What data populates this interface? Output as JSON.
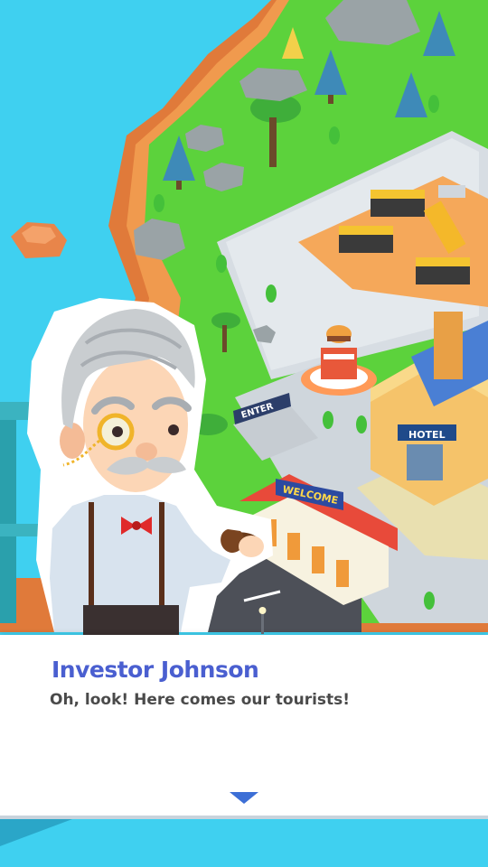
{
  "dialog": {
    "speaker_name": "Investor Johnson",
    "message": "Oh, look! Here comes our tourists!",
    "continue_icon": "triangle-down-icon"
  },
  "map_signs": {
    "enter_sign": "ENTER",
    "welcome_sign": "WELCOME",
    "hotel_sign": "HOTEL"
  },
  "colors": {
    "water": "#3fd0f0",
    "grass": "#5cd23c",
    "speaker_name": "#4a5fd0",
    "message_text": "#4a4a4a",
    "continue_arrow": "#3d6fd6"
  }
}
